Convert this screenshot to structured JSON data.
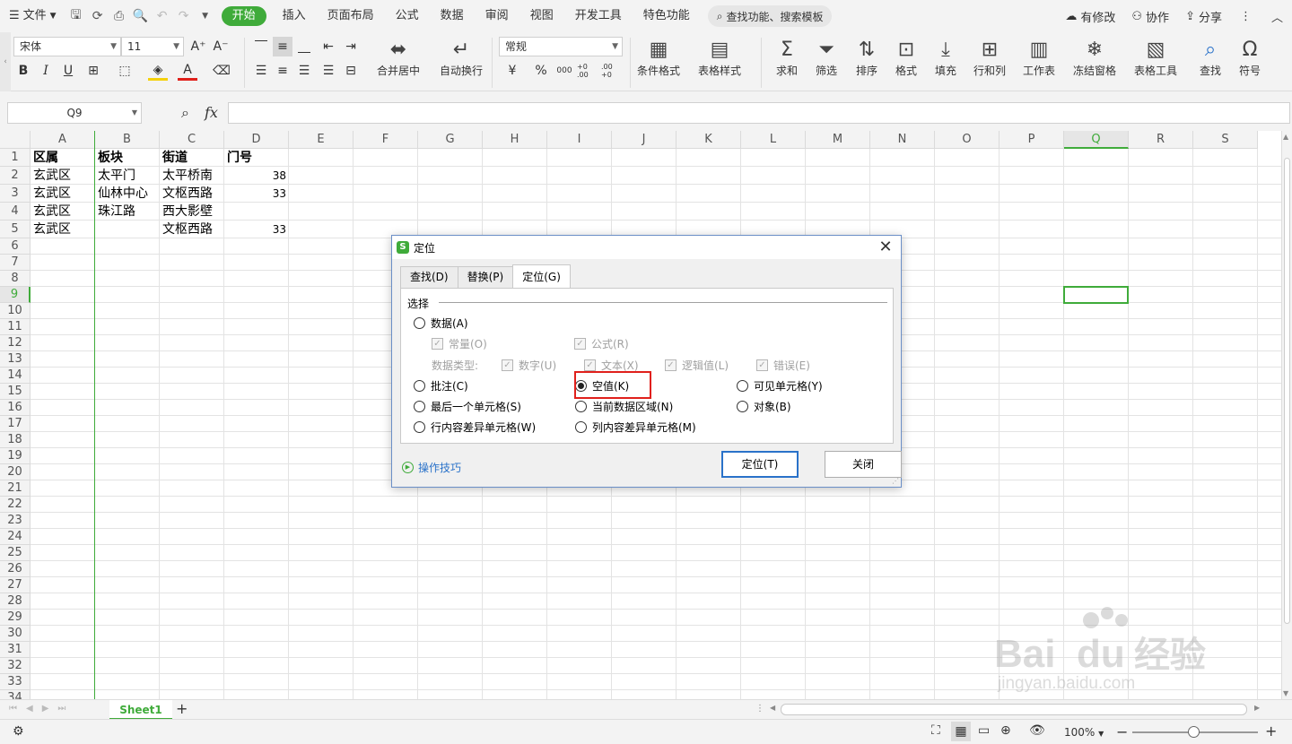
{
  "menu": {
    "file": "文件",
    "tabs": [
      "开始",
      "插入",
      "页面布局",
      "公式",
      "数据",
      "审阅",
      "视图",
      "开发工具",
      "特色功能"
    ],
    "search": "查找功能、搜索模板",
    "right": [
      "有修改",
      "协作",
      "分享"
    ]
  },
  "ribbon": {
    "font_name": "宋体",
    "font_size": "11",
    "number_format": "常规",
    "merge_center": "合并居中",
    "wrap_text": "自动换行",
    "currency": "¥",
    "percent": "%",
    "thousands": "000",
    "decimal_inc": "+0 .00",
    "decimal_dec": ".00 +0",
    "big_buttons": [
      "条件格式",
      "表格样式",
      "求和",
      "筛选",
      "排序",
      "格式",
      "填充",
      "行和列",
      "工作表",
      "冻结窗格",
      "表格工具",
      "查找",
      "符号"
    ]
  },
  "formula_bar": {
    "name_box": "Q9",
    "fx": "fx",
    "value": ""
  },
  "sheet": {
    "columns": [
      "A",
      "B",
      "C",
      "D",
      "E",
      "F",
      "G",
      "H",
      "I",
      "J",
      "K",
      "L",
      "M",
      "N",
      "O",
      "P",
      "Q",
      "R",
      "S"
    ],
    "selected_column": "Q",
    "rows": [
      "1",
      "2",
      "3",
      "4",
      "5",
      "6",
      "7",
      "8",
      "9",
      "10",
      "11",
      "12",
      "13",
      "14",
      "15",
      "16",
      "17",
      "18",
      "19",
      "20",
      "21",
      "22",
      "23",
      "24",
      "25",
      "26",
      "27",
      "28",
      "29",
      "30",
      "31",
      "32",
      "33",
      "34"
    ],
    "selected_row": "9",
    "header": [
      "区属",
      "板块",
      "街道",
      "门号"
    ],
    "data": [
      [
        "玄武区",
        "太平门",
        "太平桥南",
        "38"
      ],
      [
        "玄武区",
        "仙林中心",
        "文枢西路",
        "33"
      ],
      [
        "玄武区",
        "珠江路",
        "西大影壁",
        ""
      ],
      [
        "玄武区",
        "",
        "文枢西路",
        "33"
      ]
    ]
  },
  "sheet_tabs": {
    "active": "Sheet1",
    "add": "+"
  },
  "status": {
    "zoom": "100%"
  },
  "dialog": {
    "title": "定位",
    "logo": "S",
    "tabs": [
      "查找(D)",
      "替换(P)",
      "定位(G)"
    ],
    "active_tab": "定位(G)",
    "group_label": "选择",
    "opt_data": "数据(A)",
    "chk_constant": "常量(O)",
    "chk_formula": "公式(R)",
    "data_type_label": "数据类型:",
    "chk_number": "数字(U)",
    "chk_text": "文本(X)",
    "chk_logical": "逻辑值(L)",
    "chk_error": "错误(E)",
    "opt_comment": "批注(C)",
    "opt_blank": "空值(K)",
    "opt_visible": "可见单元格(Y)",
    "opt_last_cell": "最后一个单元格(S)",
    "opt_current_region": "当前数据区域(N)",
    "opt_object": "对象(B)",
    "opt_row_diff": "行内容差异单元格(W)",
    "opt_col_diff": "列内容差异单元格(M)",
    "selected_option": "空值(K)",
    "tips": "操作技巧",
    "btn_locate": "定位(T)",
    "btn_close": "关闭"
  },
  "colors": {
    "accent": "#3fab3a",
    "highlight": "#e0201b",
    "link": "#2a72c9"
  }
}
